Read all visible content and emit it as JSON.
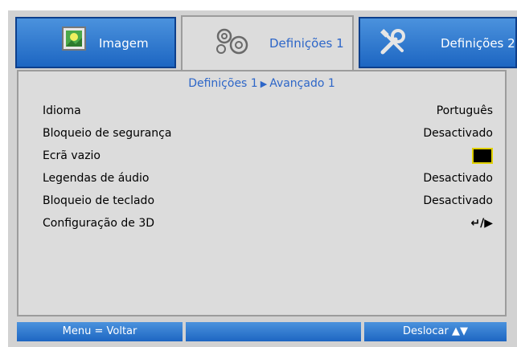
{
  "tabs": [
    {
      "label": "Imagem",
      "icon": "image-icon",
      "active": false
    },
    {
      "label": "Definições 1",
      "icon": "gears-icon",
      "active": true
    },
    {
      "label": "Definições 2",
      "icon": "tools-icon",
      "active": false
    }
  ],
  "breadcrumb": {
    "parent": "Definições 1",
    "separator": "▶",
    "current": "Avançado 1"
  },
  "menu": [
    {
      "label": "Idioma",
      "value": "Português"
    },
    {
      "label": "Bloqueio de segurança",
      "value": "Desactivado"
    },
    {
      "label": "Ecrã vazio",
      "value": "",
      "swatch": "#000000"
    },
    {
      "label": "Legendas de áudio",
      "value": "Desactivado"
    },
    {
      "label": "Bloqueio de teclado",
      "value": "Desactivado"
    },
    {
      "label": "Configuração de 3D",
      "value": "↵/▶"
    }
  ],
  "footer": {
    "left": "Menu = Voltar",
    "middle": "",
    "right": "Deslocar ▲▼"
  },
  "colors": {
    "accent": "#2d66c8",
    "tab_bg": "#1d66c2",
    "panel_bg": "#dcdcdc",
    "highlight": "#e0d000"
  }
}
